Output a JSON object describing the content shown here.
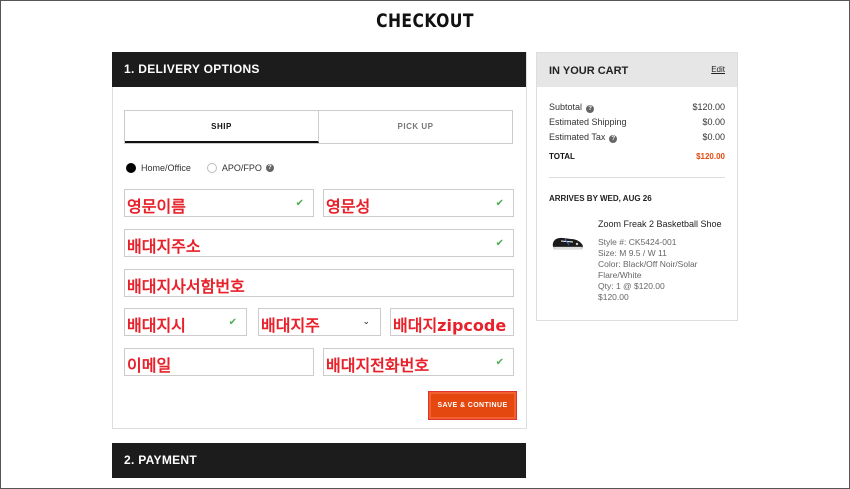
{
  "page_title": "CHECKOUT",
  "delivery": {
    "header": "1. DELIVERY OPTIONS",
    "tabs": [
      "SHIP",
      "PICK UP"
    ],
    "radio_options": [
      "Home/Office",
      "APO/FPO"
    ],
    "fields": {
      "first_name": "영문이름",
      "last_name": "영문성",
      "address1": "배대지주소",
      "address2": "배대지사서함번호",
      "city": "배대지시",
      "state": "배대지주",
      "zip": "배대지zipcode",
      "email": "이메일",
      "phone": "배대지전화번호"
    },
    "continue_button": "SAVE & CONTINUE"
  },
  "payment": {
    "header": "2. PAYMENT"
  },
  "cart": {
    "title": "IN YOUR CART",
    "edit": "Edit",
    "subtotal_label": "Subtotal",
    "subtotal": "$120.00",
    "shipping_label": "Estimated Shipping",
    "shipping": "$0.00",
    "tax_label": "Estimated Tax",
    "tax": "$0.00",
    "total_label": "TOTAL",
    "total": "$120.00",
    "arrives": "ARRIVES BY WED, AUG 26",
    "product": {
      "name": "Zoom Freak 2 Basketball Shoe",
      "style": "Style #:  CK5424-001",
      "size": "Size:  M 9.5 / W 11",
      "color": "Color:  Black/Off Noir/Solar Flare/White",
      "qty": "Qty:  1 @ $120.00",
      "price": "$120.00"
    }
  },
  "colors": {
    "accent": "#e4480f",
    "header_bg": "#1c1c1c",
    "check": "#4caf50"
  }
}
